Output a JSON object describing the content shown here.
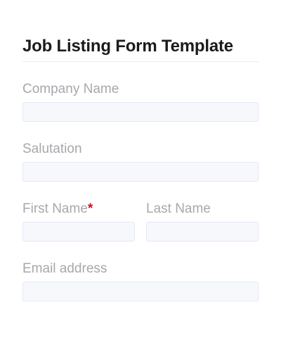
{
  "form": {
    "title": "Job Listing Form Template",
    "fields": {
      "company_name": {
        "label": "Company Name",
        "value": ""
      },
      "salutation": {
        "label": "Salutation",
        "value": ""
      },
      "first_name": {
        "label": "First Name",
        "required_mark": "*",
        "value": ""
      },
      "last_name": {
        "label": "Last Name",
        "value": ""
      },
      "email": {
        "label": "Email address",
        "value": ""
      }
    }
  },
  "colors": {
    "label": "#a8a8ad",
    "required": "#d4101f",
    "input_bg": "#f7f8fc",
    "input_border": "#e4e8f7"
  }
}
